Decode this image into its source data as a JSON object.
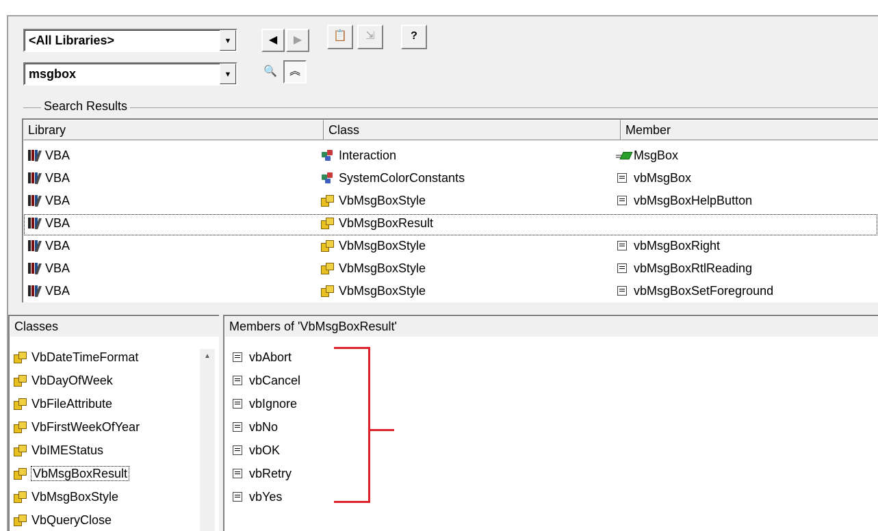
{
  "toolbar": {
    "library_combo": "<All Libraries>",
    "search_combo": "msgbox",
    "help_glyph": "?"
  },
  "search_results": {
    "label": "Search Results",
    "columns": [
      "Library",
      "Class",
      "Member"
    ],
    "rows": [
      {
        "library": "VBA",
        "class": "Interaction",
        "class_icon": "class-icon",
        "member": "MsgBox",
        "member_icon": "method-icon"
      },
      {
        "library": "VBA",
        "class": "SystemColorConstants",
        "class_icon": "class-icon",
        "member": "vbMsgBox",
        "member_icon": "constant-icon"
      },
      {
        "library": "VBA",
        "class": "VbMsgBoxStyle",
        "class_icon": "enum-icon",
        "member": "vbMsgBoxHelpButton",
        "member_icon": "constant-icon"
      },
      {
        "library": "VBA",
        "class": "VbMsgBoxResult",
        "class_icon": "enum-icon",
        "member": "",
        "member_icon": "",
        "selected": true
      },
      {
        "library": "VBA",
        "class": "VbMsgBoxStyle",
        "class_icon": "enum-icon",
        "member": "vbMsgBoxRight",
        "member_icon": "constant-icon"
      },
      {
        "library": "VBA",
        "class": "VbMsgBoxStyle",
        "class_icon": "enum-icon",
        "member": "vbMsgBoxRtlReading",
        "member_icon": "constant-icon"
      },
      {
        "library": "VBA",
        "class": "VbMsgBoxStyle",
        "class_icon": "enum-icon",
        "member": "vbMsgBoxSetForeground",
        "member_icon": "constant-icon"
      }
    ]
  },
  "classes": {
    "header": "Classes",
    "items": [
      "VbDateTimeFormat",
      "VbDayOfWeek",
      "VbFileAttribute",
      "VbFirstWeekOfYear",
      "VbIMEStatus",
      "VbMsgBoxResult",
      "VbMsgBoxStyle",
      "VbQueryClose"
    ],
    "selected": "VbMsgBoxResult"
  },
  "members": {
    "header": "Members of 'VbMsgBoxResult'",
    "items": [
      "vbAbort",
      "vbCancel",
      "vbIgnore",
      "vbNo",
      "vbOK",
      "vbRetry",
      "vbYes"
    ]
  },
  "colors": {
    "annotation_bracket": "#e0202a",
    "panel_bg": "#f0f0f0"
  }
}
